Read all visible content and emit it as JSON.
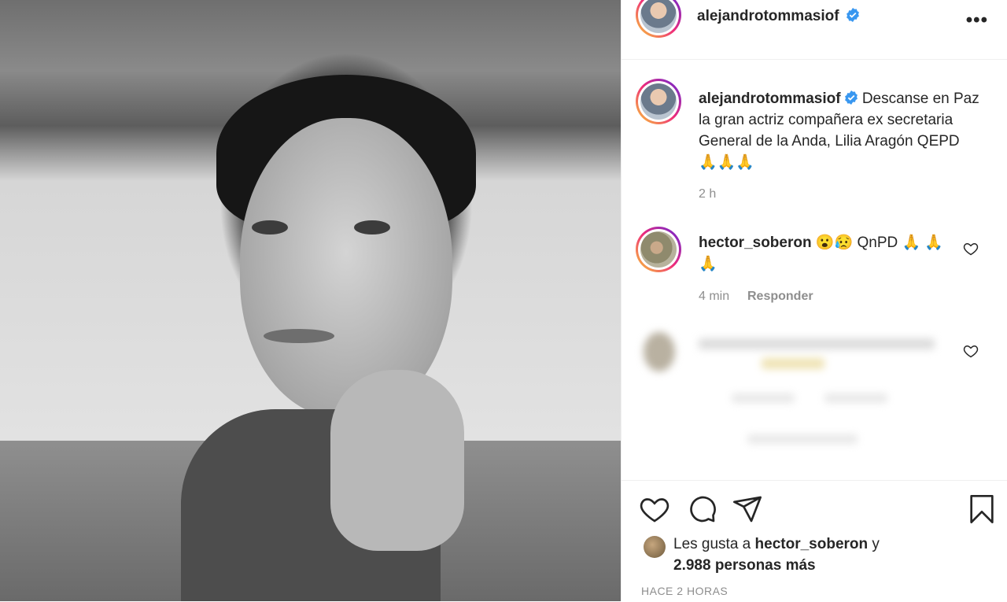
{
  "post": {
    "image_alt": "photo",
    "author": {
      "username": "alejandrotommasiof",
      "verified": true
    },
    "more_icon": "more-options-icon",
    "caption": {
      "username": "alejandrotommasiof",
      "text": "Descanse en Paz la gran actriz compañera ex secretaria General de la Anda, Lilia Aragón QEPD 🙏🙏🙏",
      "time": "2 h"
    },
    "comments": [
      {
        "username": "hector_soberon",
        "text": "😮😥 QnPD 🙏 🙏🙏",
        "time": "4 min",
        "reply_label": "Responder"
      }
    ],
    "actions": {
      "like_icon": "heart-icon",
      "comment_icon": "comment-icon",
      "share_icon": "share-icon",
      "save_icon": "bookmark-icon"
    },
    "likes": {
      "prefix": "Les gusta a",
      "user": "hector_soberon",
      "connector": "y",
      "count_text": "2.988 personas más"
    },
    "timestamp": "HACE 2 HORAS"
  },
  "colors": {
    "text": "#262626",
    "muted": "#8e8e8e",
    "verified": "#3897f0",
    "border": "#efefef"
  }
}
